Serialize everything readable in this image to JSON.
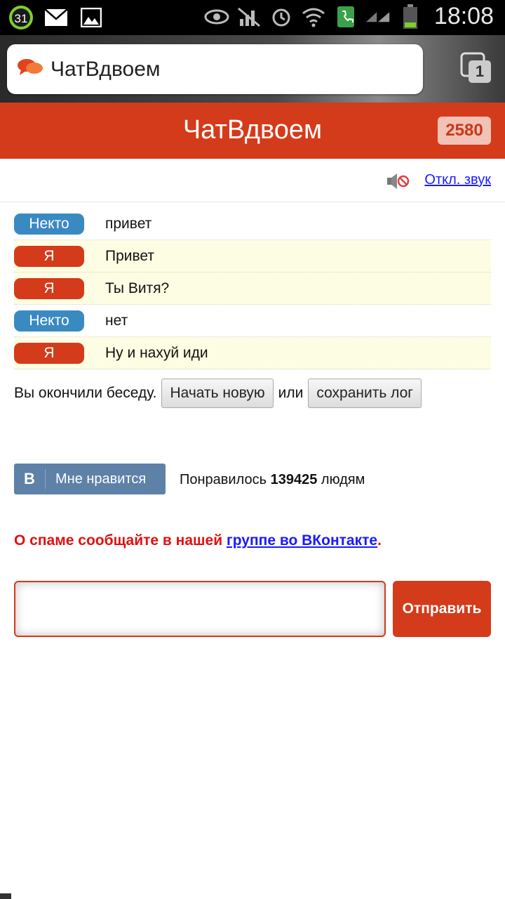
{
  "status_bar": {
    "calendar_day": "31",
    "time": "18:08",
    "icons": [
      "calendar-icon",
      "mail-icon",
      "image-icon",
      "eye-icon",
      "mute-icon",
      "alarm-icon",
      "wifi-icon",
      "phone-icon",
      "signal-icon",
      "battery-icon"
    ]
  },
  "browser": {
    "url_title": "ЧатВдвоем",
    "tab_count": "1"
  },
  "header": {
    "title": "ЧатВдвоем",
    "online_count": "2580"
  },
  "sound": {
    "toggle_label": "Откл. звук"
  },
  "chat": {
    "messages": [
      {
        "sender": "Некто",
        "text": "привет",
        "mine": false
      },
      {
        "sender": "Я",
        "text": "Привет",
        "mine": true
      },
      {
        "sender": "Я",
        "text": "Ты Витя?",
        "mine": true
      },
      {
        "sender": "Некто",
        "text": "нет",
        "mine": false
      },
      {
        "sender": "Я",
        "text": "Ну и нахуй иди",
        "mine": true
      }
    ],
    "ended_text": "Вы окончили беседу.",
    "new_chat_button": "Начать новую",
    "or_text": "или",
    "save_log_button": "сохранить лог"
  },
  "vk": {
    "logo": "В",
    "like_label": "Мне нравится",
    "liked_prefix": "Понравилось",
    "liked_count": "139425",
    "liked_suffix": "людям"
  },
  "spam": {
    "text": "О спаме сообщайте в нашей",
    "link_text": "группе во ВКонтакте",
    "end": "."
  },
  "composer": {
    "input_value": "",
    "send_button": "Отправить"
  },
  "colors": {
    "brand": "#d43b1a",
    "stranger": "#3a8ac2",
    "vk": "#5e81a8"
  }
}
